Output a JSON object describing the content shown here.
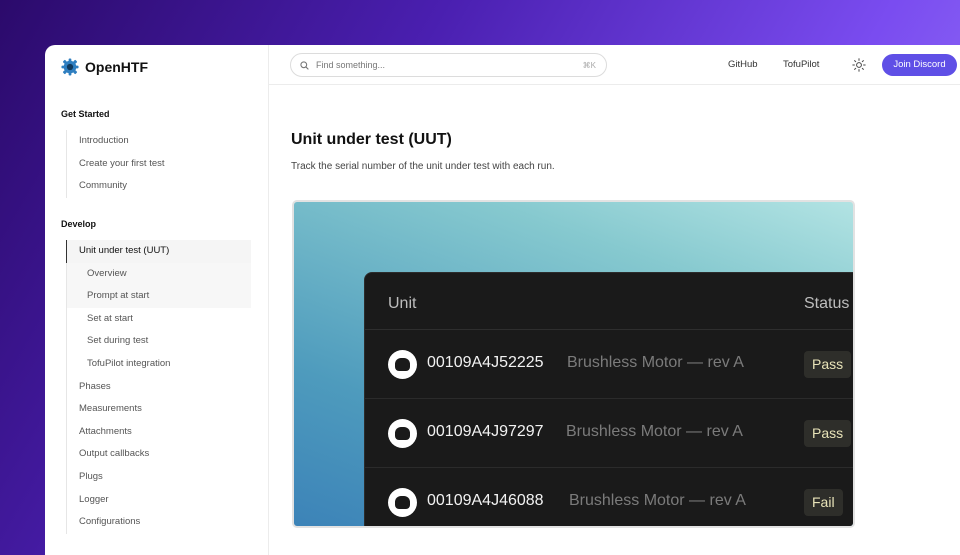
{
  "app": {
    "name": "OpenHTF"
  },
  "sidebar": {
    "sections": [
      {
        "title": "Get Started",
        "items": [
          "Introduction",
          "Create your first test",
          "Community"
        ]
      },
      {
        "title": "Develop",
        "items": [
          "Unit under test (UUT)",
          "Overview",
          "Prompt at start",
          "Set at start",
          "Set during test",
          "TofuPilot integration",
          "Phases",
          "Measurements",
          "Attachments",
          "Output callbacks",
          "Plugs",
          "Logger",
          "Configurations"
        ]
      }
    ]
  },
  "header": {
    "search_placeholder": "Find something...",
    "search_shortcut": "⌘K",
    "links": [
      "GitHub",
      "TofuPilot"
    ],
    "theme_icon": "sun-icon",
    "cta_label": "Join Discord",
    "cta_color": "#5f4fe6"
  },
  "main": {
    "title": "Unit under test (UUT)",
    "subtitle": "Track the serial number of the unit under test with each run.",
    "preview": {
      "columns": [
        "Unit",
        "Status"
      ],
      "rows": [
        {
          "serial": "00109A4J52225",
          "model": "Brushless Motor — rev A",
          "status": "Pass"
        },
        {
          "serial": "00109A4J97297",
          "model": "Brushless Motor — rev A",
          "status": "Pass"
        },
        {
          "serial": "00109A4J46088",
          "model": "Brushless Motor — rev A",
          "status": "Fail"
        }
      ]
    }
  }
}
